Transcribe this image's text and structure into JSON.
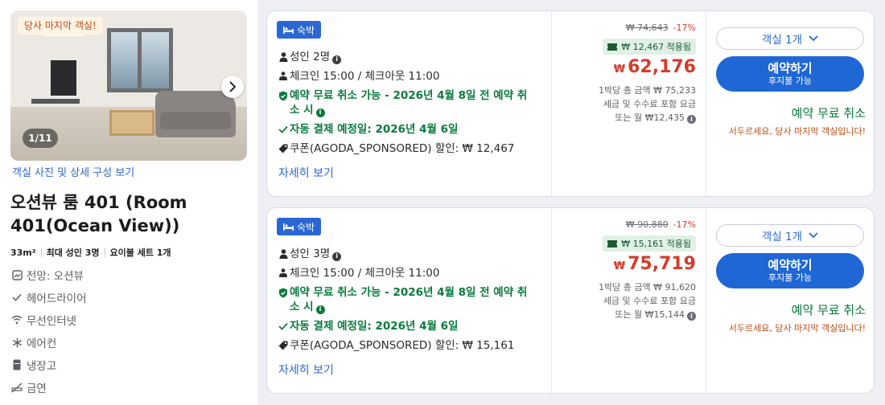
{
  "room": {
    "badge": "당사 마지막 객실!",
    "photo_counter": "1/11",
    "gallery_link": "객실 사진 및 상세 구성 보기",
    "title": "오션뷰 룸 401 (Room 401(Ocean View))",
    "specs": [
      "33m²",
      "최대 성인 3명",
      "요이불 세트 1개"
    ],
    "amenities": [
      {
        "icon": "view-icon",
        "label": "전망: 오션뷰"
      },
      {
        "icon": "check-icon",
        "label": "헤어드라이어"
      },
      {
        "icon": "wifi-icon",
        "label": "무선인터넷"
      },
      {
        "icon": "snowflake-icon",
        "label": "에어컨"
      },
      {
        "icon": "fridge-icon",
        "label": "냉장고"
      },
      {
        "icon": "no-smoking-icon",
        "label": "금연"
      }
    ]
  },
  "offers": [
    {
      "stay_tag": "숙박",
      "guests": "성인 2명",
      "check_times": "체크인 15:00 / 체크아웃 11:00",
      "free_cancel_line1": "예약 무료 취소 가능 - 2026년 4월 8일 전 예약 취",
      "free_cancel_line2": "소 시",
      "auto_pay": "자동 결제 예정일: 2026년 4월 6일",
      "coupon": "쿠폰(AGODA_SPONSORED) 할인: ₩ 12,467",
      "details_link": "자세히 보기",
      "original_price": "₩ 74,643",
      "discount_pct": "-17%",
      "coupon_applied": "₩ 12,467 적용됨",
      "currency": "₩",
      "final_price": "62,176",
      "per_night_total": "1박당 총 금액 ₩ 75,233",
      "tax_note": "세금 및 수수료 포함 요금",
      "monthly": "또는 월 ₩12,435",
      "room_select": "객실 1개",
      "reserve_label": "예약하기",
      "reserve_sub": "후지불 가능",
      "free_cancel_short": "예약 무료 취소",
      "urgency": "서두르세요, 당사 마지막 객실입니다!"
    },
    {
      "stay_tag": "숙박",
      "guests": "성인 3명",
      "check_times": "체크인 15:00 / 체크아웃 11:00",
      "free_cancel_line1": "예약 무료 취소 가능 - 2026년 4월 8일 전 예약 취",
      "free_cancel_line2": "소 시",
      "auto_pay": "자동 결제 예정일: 2026년 4월 6일",
      "coupon": "쿠폰(AGODA_SPONSORED) 할인: ₩ 15,161",
      "details_link": "자세히 보기",
      "original_price": "₩ 90,880",
      "discount_pct": "-17%",
      "coupon_applied": "₩ 15,161 적용됨",
      "currency": "₩",
      "final_price": "75,719",
      "per_night_total": "1박당 총 금액 ₩ 91,620",
      "tax_note": "세금 및 수수료 포함 요금",
      "monthly": "또는 월 ₩15,144",
      "room_select": "객실 1개",
      "reserve_label": "예약하기",
      "reserve_sub": "후지불 가능",
      "free_cancel_short": "예약 무료 취소",
      "urgency": "서두르세요, 당사 마지막 객실입니다!"
    }
  ],
  "colors": {
    "accent_blue": "#2067d6",
    "price_red": "#d43b2a",
    "green": "#0a7a3d",
    "urgency_orange": "#c04a12"
  }
}
